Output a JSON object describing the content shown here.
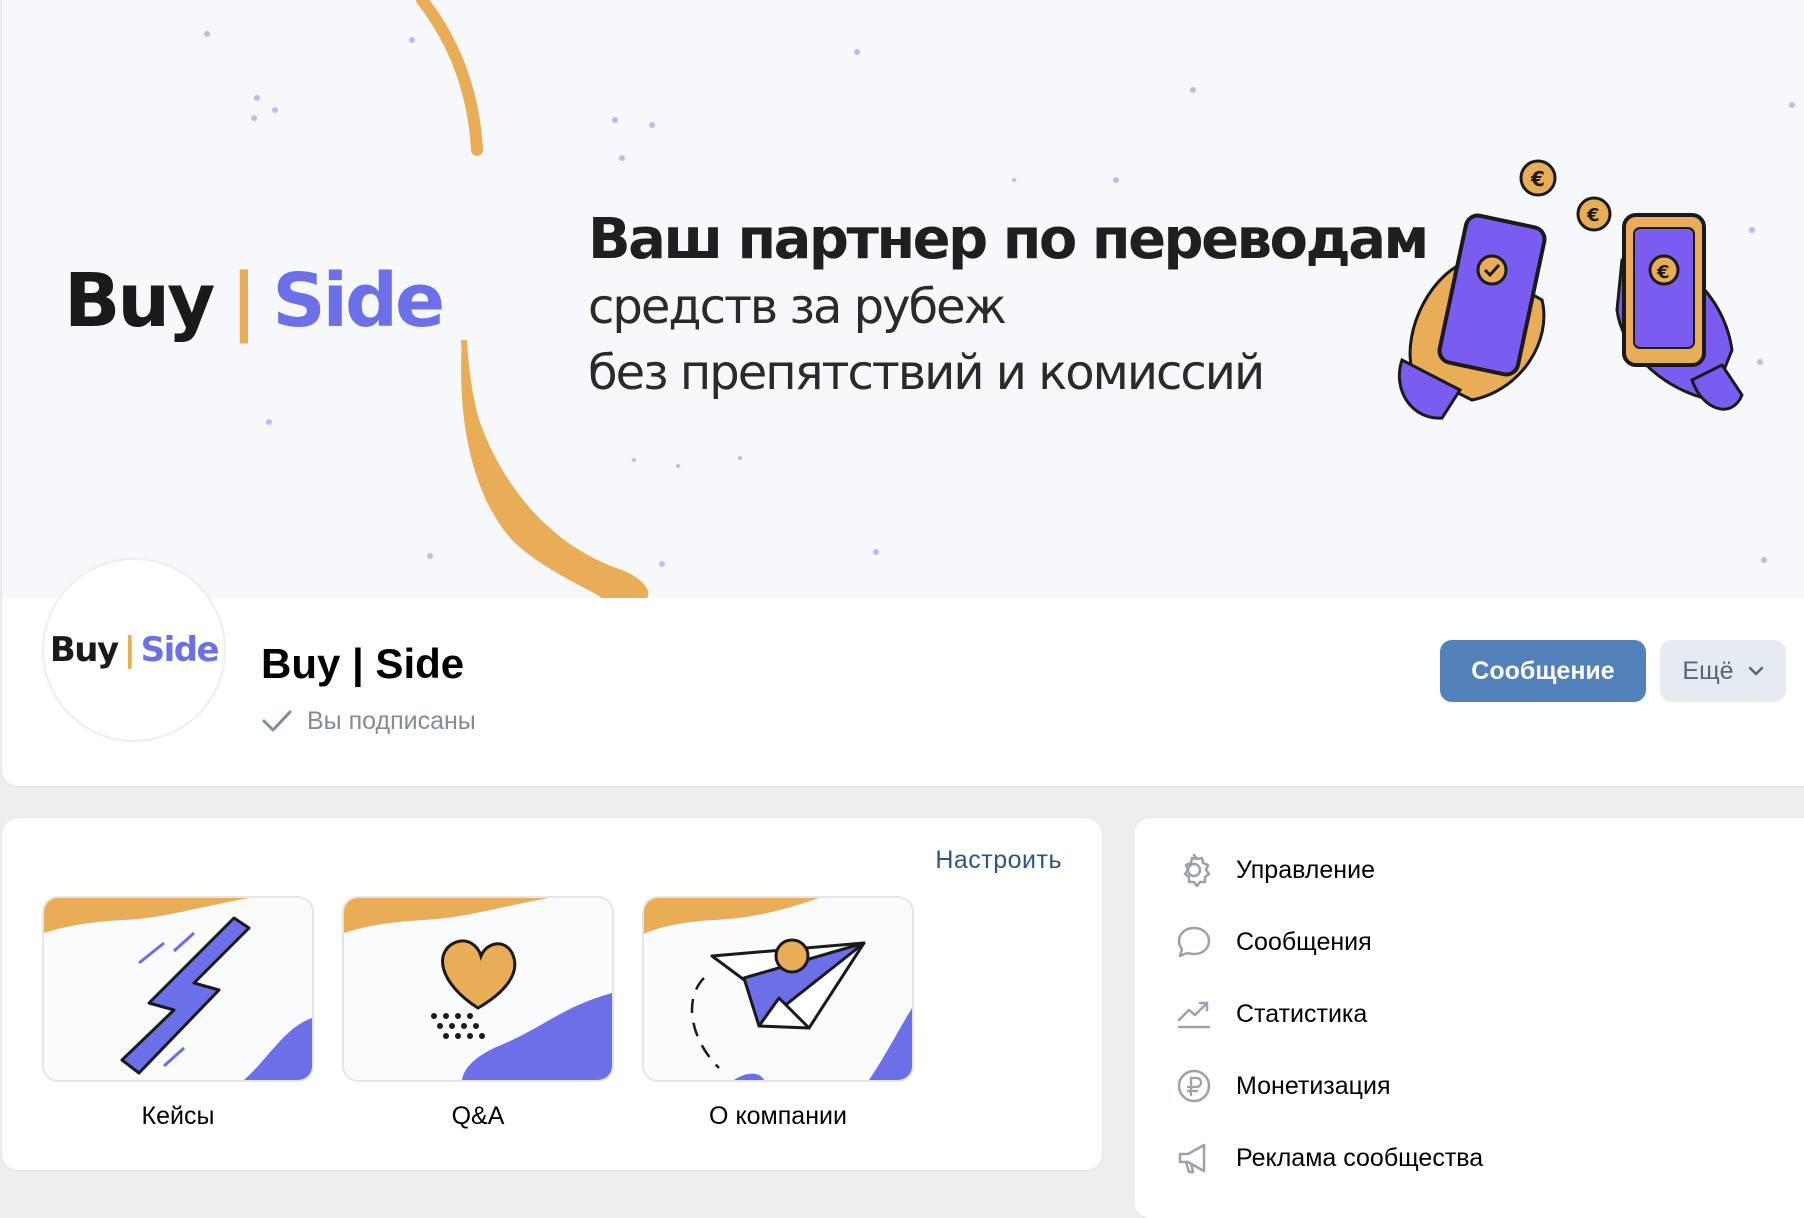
{
  "cover": {
    "logo_left": "Buy",
    "logo_sep": "|",
    "logo_right": "Side",
    "headline": "Ваш партнер по переводам",
    "line2": "средств за рубеж",
    "line3": "без препятствий и комиссий"
  },
  "avatar": {
    "left": "Buy",
    "sep": "|",
    "right": "Side"
  },
  "group": {
    "name": "Buy | Side",
    "status": "Вы подписаны"
  },
  "actions": {
    "message_label": "Сообщение",
    "more_label": "Ещё"
  },
  "widgets": {
    "configure_label": "Настроить",
    "tiles": [
      {
        "label": "Кейсы",
        "icon": "lightning-icon"
      },
      {
        "label": "Q&A",
        "icon": "heart-icon"
      },
      {
        "label": "О компании",
        "icon": "paper-plane-icon"
      }
    ]
  },
  "menu": {
    "items": [
      {
        "label": "Управление",
        "icon": "gear-icon"
      },
      {
        "label": "Сообщения",
        "icon": "chat-bubble-icon"
      },
      {
        "label": "Статистика",
        "icon": "stats-trend-icon"
      },
      {
        "label": "Монетизация",
        "icon": "ruble-icon"
      },
      {
        "label": "Реклама сообщества",
        "icon": "megaphone-icon"
      }
    ]
  },
  "colors": {
    "accent_blue": "#5181b8",
    "brand_orange": "#e9ad58",
    "brand_purple": "#6b6fe8",
    "link": "#2a5885",
    "page_bg": "#edeef0"
  }
}
